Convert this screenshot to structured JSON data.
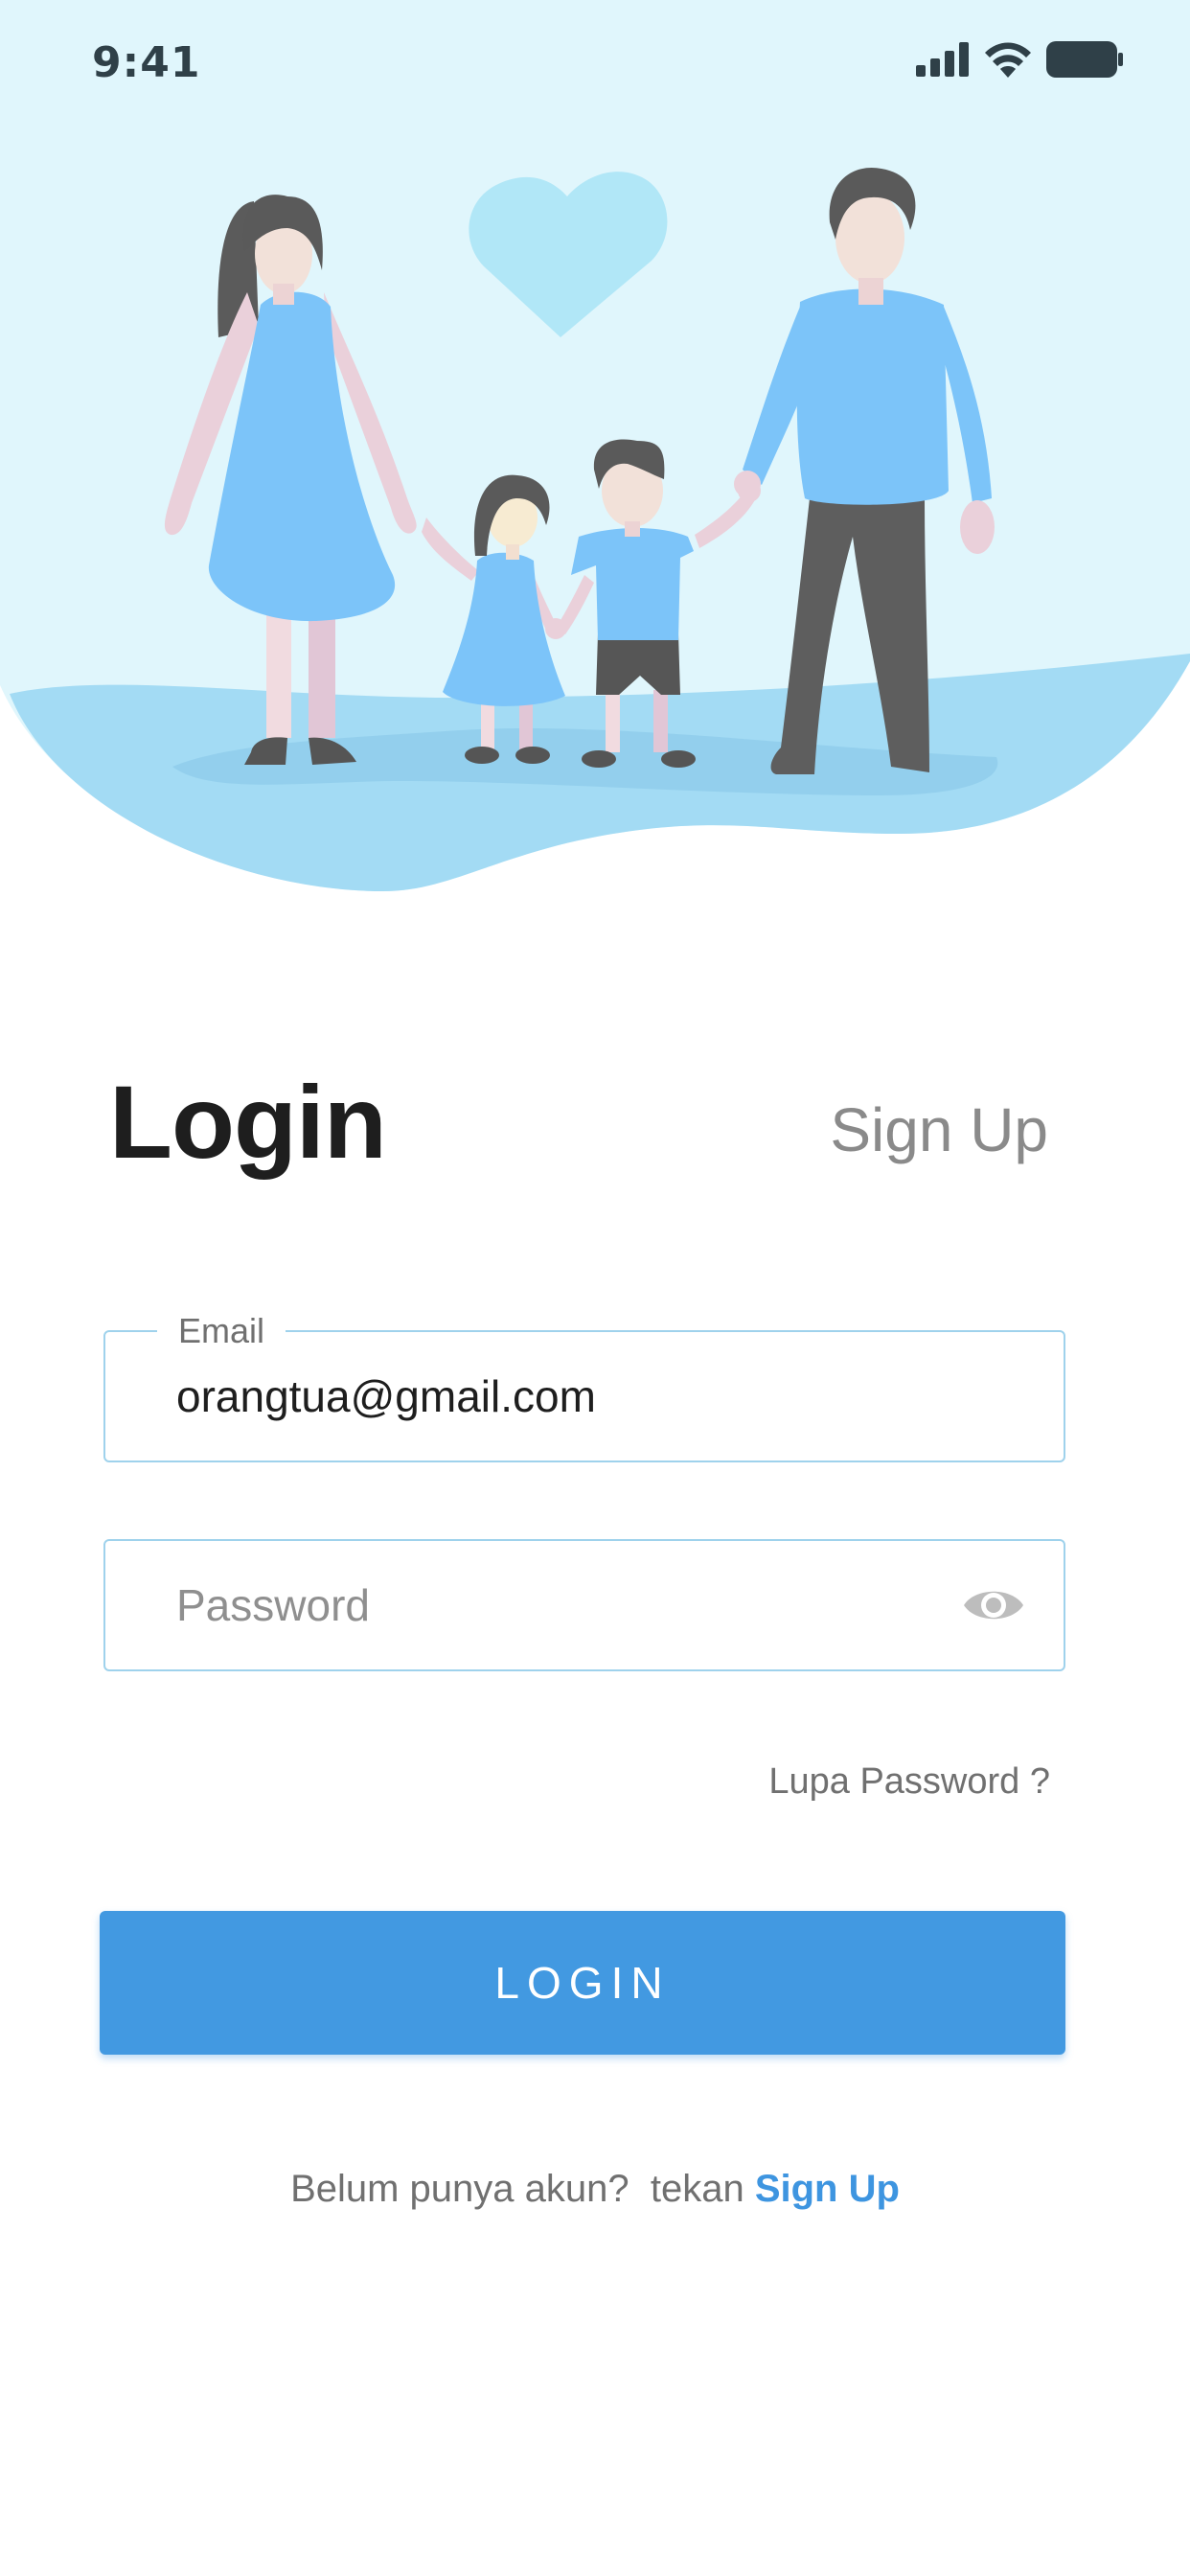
{
  "status_bar": {
    "time": "9:41",
    "icons": [
      "cellular-signal-icon",
      "wifi-icon",
      "battery-icon"
    ]
  },
  "hero": {
    "illustration": "family-holding-hands-illustration",
    "icons": [
      "heart-icon"
    ]
  },
  "header": {
    "title": "Login",
    "alt_tab": "Sign Up"
  },
  "form": {
    "email": {
      "label": "Email",
      "value": "orangtua@gmail.com"
    },
    "password": {
      "placeholder": "Password",
      "value": "",
      "toggle_icon": "eye-icon"
    },
    "forgot_password": "Lupa Password ?",
    "submit_label": "LOGIN"
  },
  "footer": {
    "prompt": "Belum punya akun?  tekan ",
    "link": "Sign Up"
  },
  "colors": {
    "primary": "#4299e1",
    "hero_bg": "#e0f6fc",
    "wave": "#a3dbf4",
    "field_border": "#9fd2ec",
    "title": "#1e1e1e",
    "muted": "#8a8a8a"
  }
}
